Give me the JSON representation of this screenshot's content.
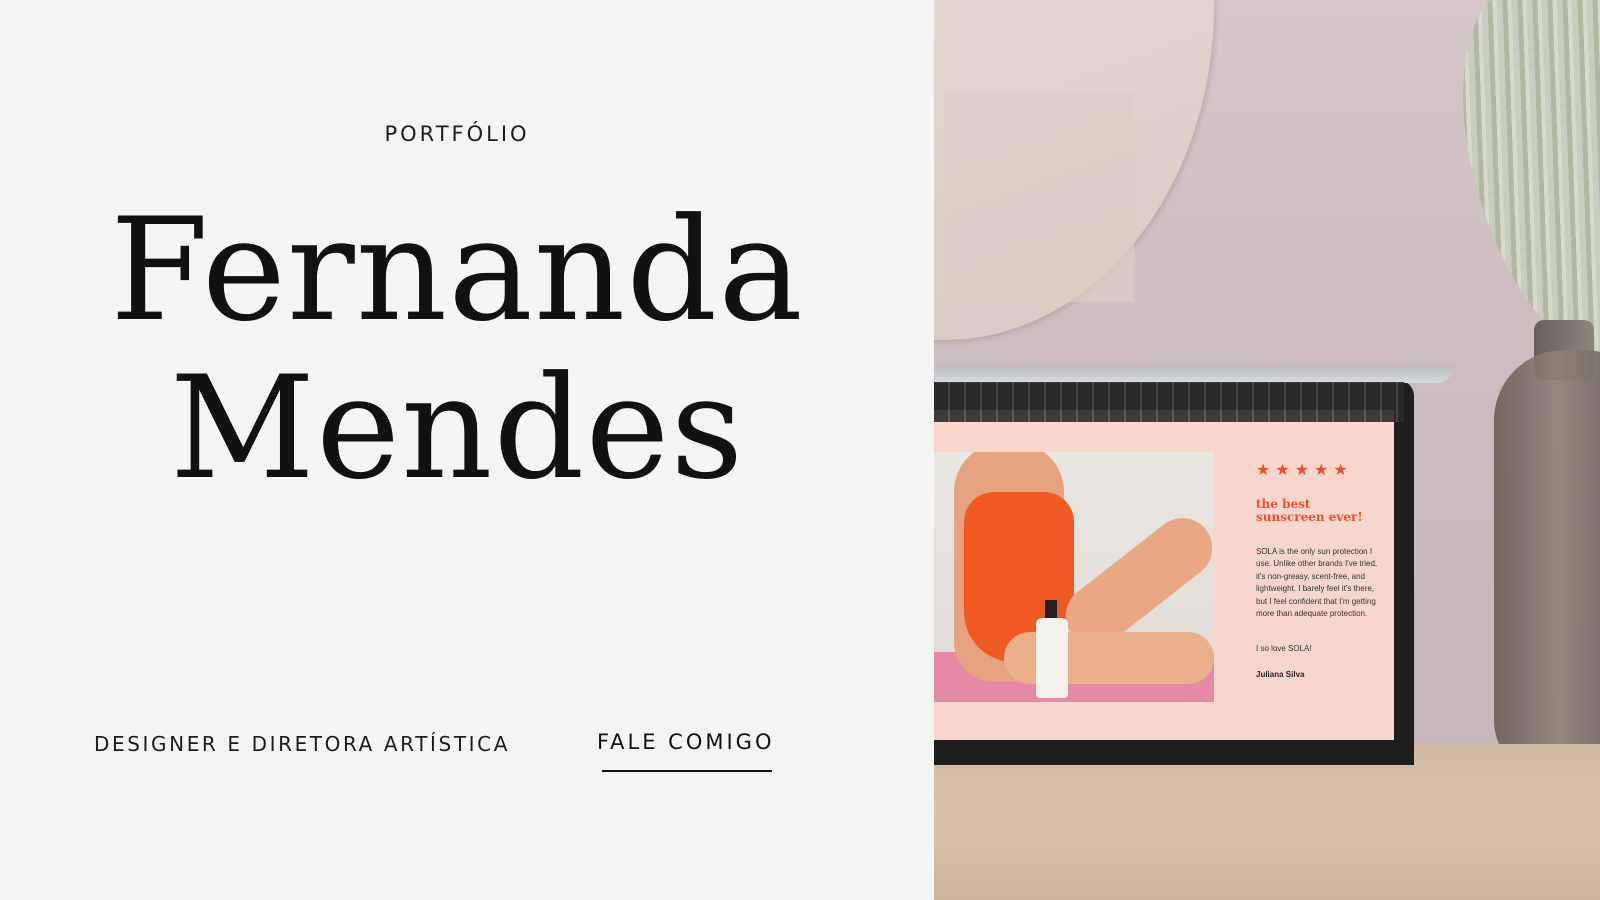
{
  "hero": {
    "eyebrow": "PORTFÓLIO",
    "name_line1": "Fernanda",
    "name_line2": "Mendes",
    "role": "DESIGNER E DIRETORA ARTÍSTICA",
    "cta_label": "FALE COMIGO"
  },
  "laptop_screen": {
    "rating_stars": "★★★★★",
    "review_title_line1": "the best",
    "review_title_line2": "sunscreen ever!",
    "review_body": "SOLA is the only sun protection I use. Unlike other brands I've tried, it's non-greasy, scent-free, and lightweight. I barely feel it's there, but I feel confident that I'm getting more than adequate protection.",
    "review_love": "I so love SOLA!",
    "reviewer": "Juliana Silva"
  },
  "colors": {
    "background": "#f5f5f5",
    "text": "#111111",
    "accent_orange": "#e8522a",
    "screen_pink": "#f9d6cd"
  }
}
